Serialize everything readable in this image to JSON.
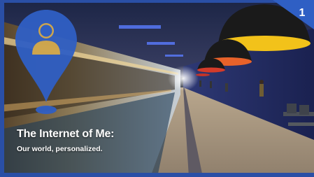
{
  "slide": {
    "number": "1",
    "title": "The Internet of Me:",
    "subtitle": "Our world, personalized."
  },
  "icons": {
    "pin": "location-pin-person-icon"
  },
  "colors": {
    "accent": "#2f5fc4",
    "frame": "#2a4fa6",
    "lamp_yellow": "#f2c21a",
    "lamp_orange": "#e8622a"
  }
}
